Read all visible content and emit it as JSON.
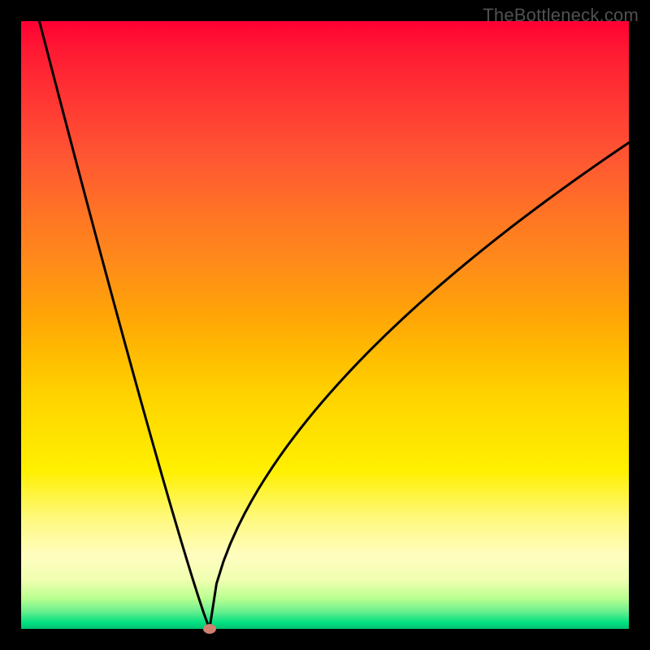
{
  "watermark": "TheBottleneck.com",
  "chart_data": {
    "type": "line",
    "title": "",
    "xlabel": "",
    "ylabel": "",
    "xlim": [
      0,
      100
    ],
    "ylim": [
      0,
      100
    ],
    "series": [
      {
        "name": "bottleneck-curve",
        "x": [
          3,
          31,
          100
        ],
        "y": [
          100,
          0,
          80
        ],
        "optimum_x": 31,
        "optimum_y": 0,
        "color": "#000000"
      }
    ],
    "marker": {
      "x": 31,
      "y": 0,
      "color": "#d08070"
    },
    "background_gradient": [
      "#ff0033",
      "#ffa300",
      "#fff000",
      "#00e080"
    ]
  }
}
